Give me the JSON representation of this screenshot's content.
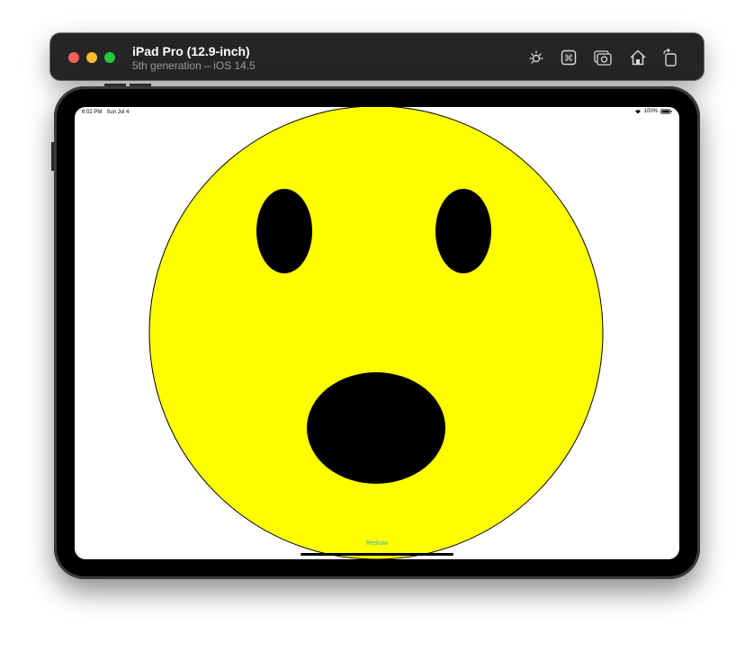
{
  "window": {
    "device_name": "iPad Pro (12.9-inch)",
    "device_info": "5th generation – iOS 14.5",
    "toolbar_buttons": [
      "brightness-icon",
      "command-icon",
      "screenshot-icon",
      "home-icon",
      "rotate-icon"
    ]
  },
  "status_bar": {
    "time": "6:02 PM",
    "date": "Sun Jul 4",
    "battery": "100%"
  },
  "app": {
    "redraw_label": "Redraw"
  },
  "colors": {
    "face": "#ffff00",
    "features": "#000000",
    "redraw": "#30b0c7"
  }
}
